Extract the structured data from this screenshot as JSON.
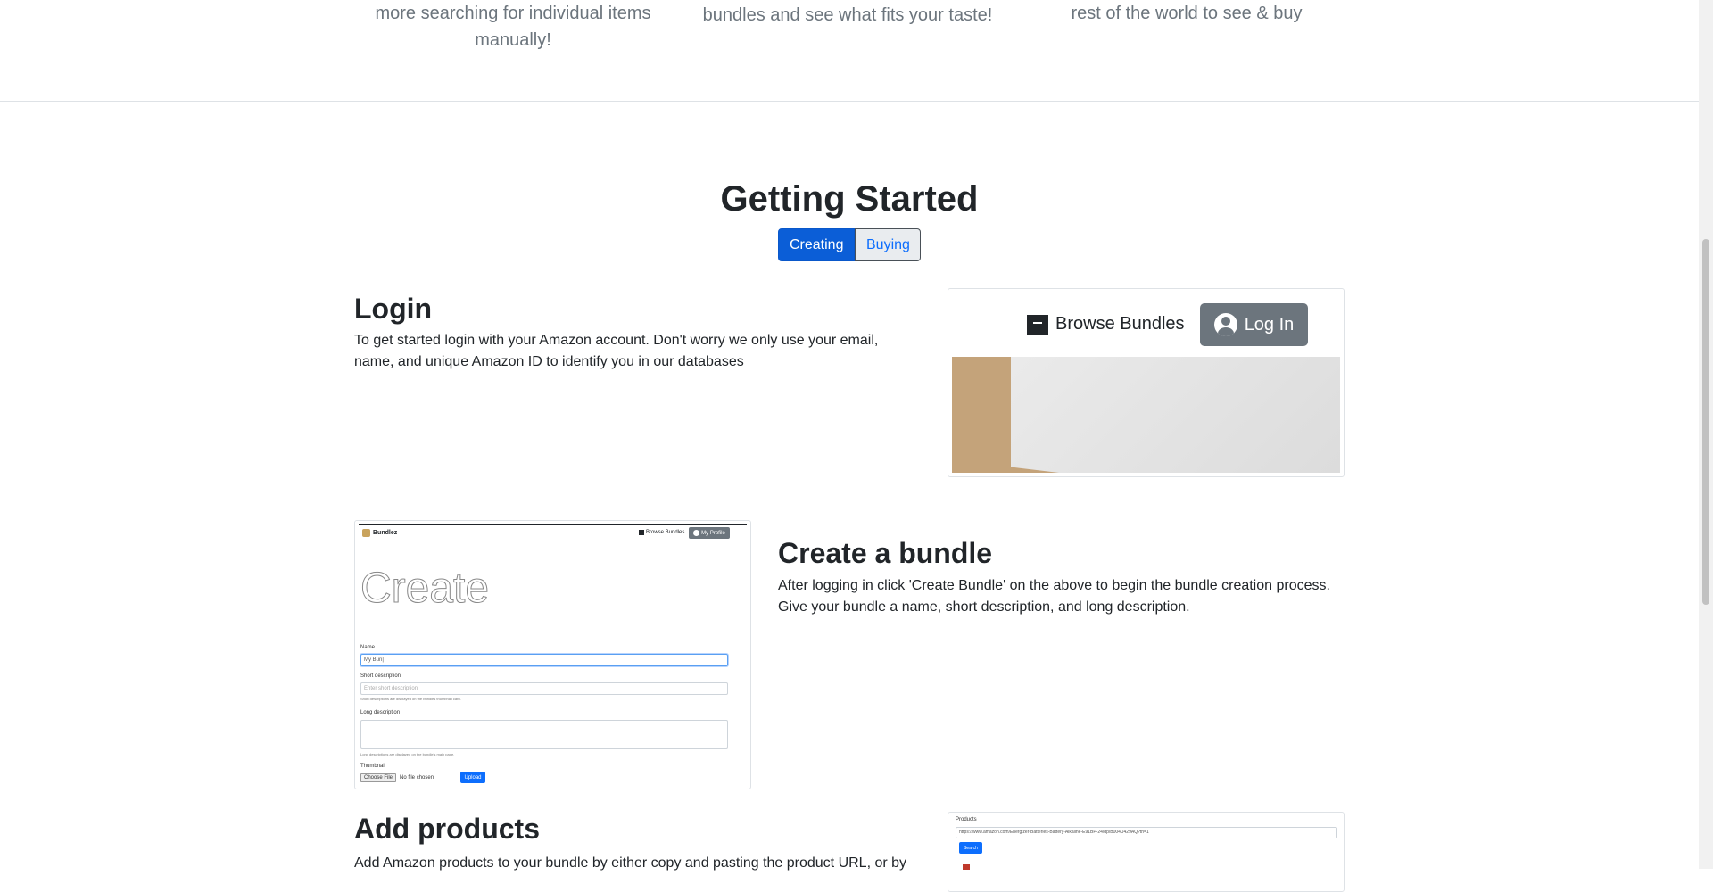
{
  "features": {
    "col1": "more searching for individual items manually!",
    "col2": "bundles and see what fits your taste!",
    "col3": "rest of the world to see & buy"
  },
  "getting_started": {
    "title": "Getting Started",
    "tabs": {
      "creating": "Creating",
      "buying": "Buying"
    }
  },
  "steps": {
    "login": {
      "title": "Login",
      "text": "To get started login with your Amazon account. Don't worry we only use your email, name, and unique Amazon ID to identify you in our databases"
    },
    "create": {
      "title": "Create a bundle",
      "text": "After logging in click 'Create Bundle' on the above to begin the bundle creation process. Give your bundle a name, short description, and long description."
    },
    "products": {
      "title": "Add products",
      "text": "Add Amazon products to your bundle by either copy and pasting the product URL, or by"
    }
  },
  "login_screenshot": {
    "browse_label": "Browse Bundles",
    "login_label": "Log In"
  },
  "create_screenshot": {
    "brand": "Bundlez",
    "browse_label": "Browse Bundles",
    "profile_label": "My Profile",
    "heading": "Create",
    "name_label": "Name",
    "name_value": "My Bun|",
    "short_label": "Short description",
    "short_placeholder": "Enter short description",
    "short_help": "Short descriptions are displayed on the bundles thumbnail card.",
    "long_label": "Long description",
    "long_help": "Long descriptions are displayed on the bundle's main page.",
    "thumb_label": "Thumbnail",
    "choose_file": "Choose File",
    "no_file": "No file chosen",
    "upload": "Upload"
  },
  "products_screenshot": {
    "label": "Products",
    "url": "https://www.amazon.com/Energizer-Batteries-Battery-Alkaline-E91BP-24/dp/B004U429AQ?th=1",
    "search": "Search"
  }
}
